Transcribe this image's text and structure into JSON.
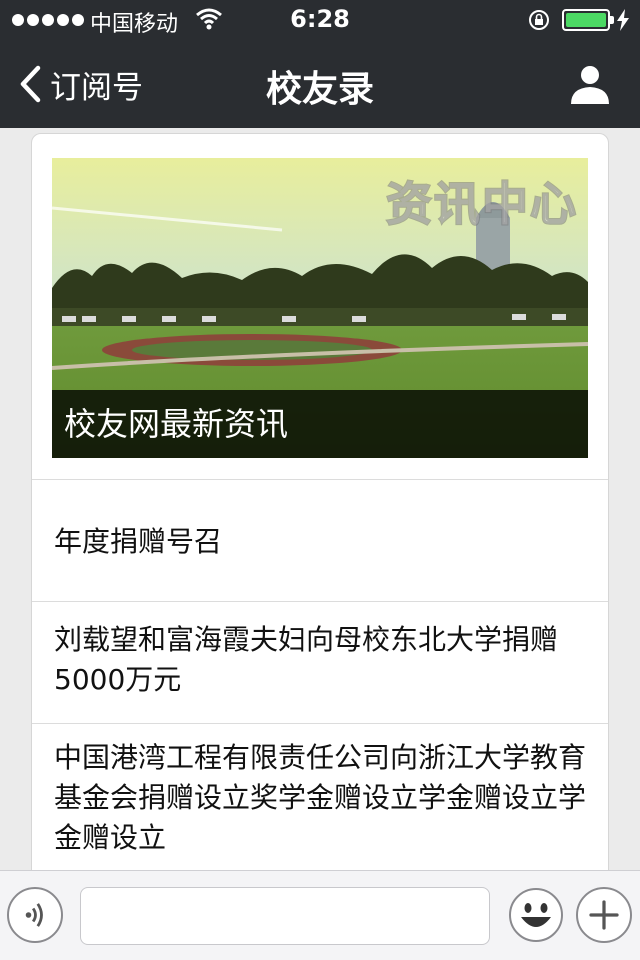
{
  "status_bar": {
    "carrier": "中国移动",
    "time": "6:28",
    "battery_level": 1.0,
    "battery_color": "#4cd964"
  },
  "nav": {
    "back_label": "订阅号",
    "title": "校友录",
    "back_icon": "chevron-left-icon",
    "profile_icon": "person-icon",
    "background": "#2a2d31"
  },
  "banner": {
    "watermark": "资讯中心",
    "caption": "校友网最新资讯"
  },
  "articles": [
    {
      "title": "年度捐赠号召"
    },
    {
      "title": "刘载望和富海霞夫妇向母校东北大学捐赠5000万元"
    },
    {
      "title": "中国港湾工程有限责任公司向浙江大学教育基金会捐赠设立奖学金赠设立学金赠设立学金赠设立"
    }
  ],
  "input_bar": {
    "input_value": "",
    "voice_icon": "voice-icon",
    "emoji_icon": "emoji-icon",
    "plus_icon": "plus-icon"
  }
}
